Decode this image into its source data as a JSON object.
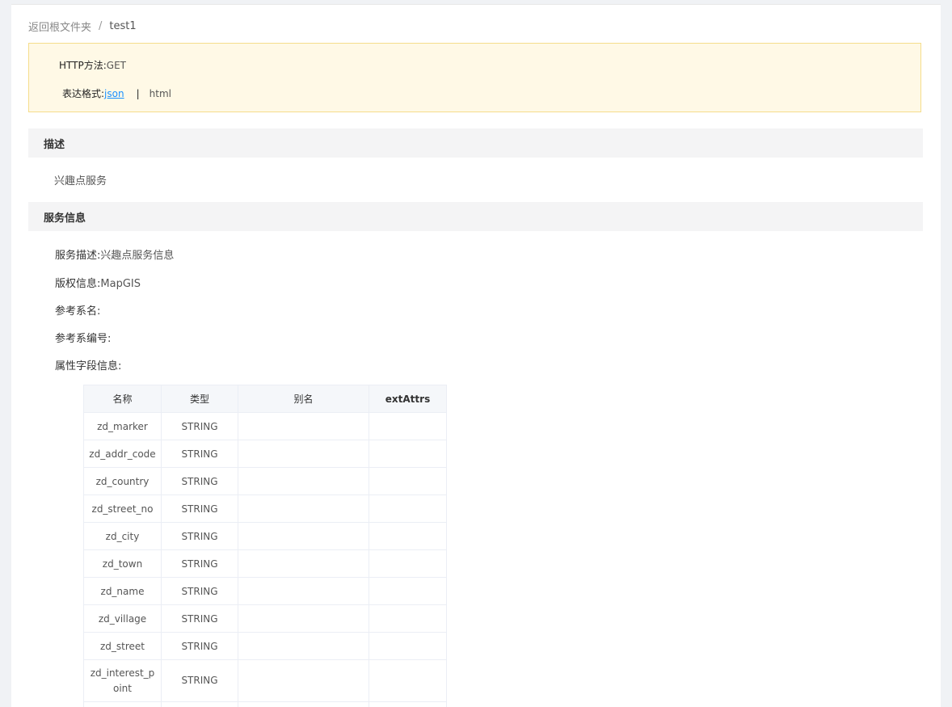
{
  "breadcrumb": {
    "back": "返回根文件夹",
    "separator": "/",
    "current": "test1"
  },
  "info": {
    "http_label": "HTTP方法:",
    "http_value": "GET",
    "format_label": "表达格式:",
    "format_json": "json",
    "format_sep": "|",
    "format_html": "html"
  },
  "sections": {
    "description": {
      "title": "描述",
      "text": "兴趣点服务"
    },
    "service_info": {
      "title": "服务信息",
      "service_desc_label": "服务描述:",
      "service_desc_value": "兴趣点服务信息",
      "copyright_label": "版权信息:",
      "copyright_value": "MapGIS",
      "ref_name_label": "参考系名:",
      "ref_name_value": "",
      "ref_code_label": "参考系编号:",
      "ref_code_value": "",
      "attr_label": "属性字段信息:"
    }
  },
  "table": {
    "headers": [
      "名称",
      "类型",
      "别名",
      "extAttrs"
    ],
    "rows": [
      [
        "zd_marker",
        "STRING",
        "",
        ""
      ],
      [
        "zd_addr_code",
        "STRING",
        "",
        ""
      ],
      [
        "zd_country",
        "STRING",
        "",
        ""
      ],
      [
        "zd_street_no",
        "STRING",
        "",
        ""
      ],
      [
        "zd_city",
        "STRING",
        "",
        ""
      ],
      [
        "zd_town",
        "STRING",
        "",
        ""
      ],
      [
        "zd_name",
        "STRING",
        "",
        ""
      ],
      [
        "zd_village",
        "STRING",
        "",
        ""
      ],
      [
        "zd_street",
        "STRING",
        "",
        ""
      ],
      [
        "zd_interest_p\noint",
        "STRING",
        "",
        ""
      ],
      [
        "",
        "",
        "",
        ""
      ]
    ]
  }
}
